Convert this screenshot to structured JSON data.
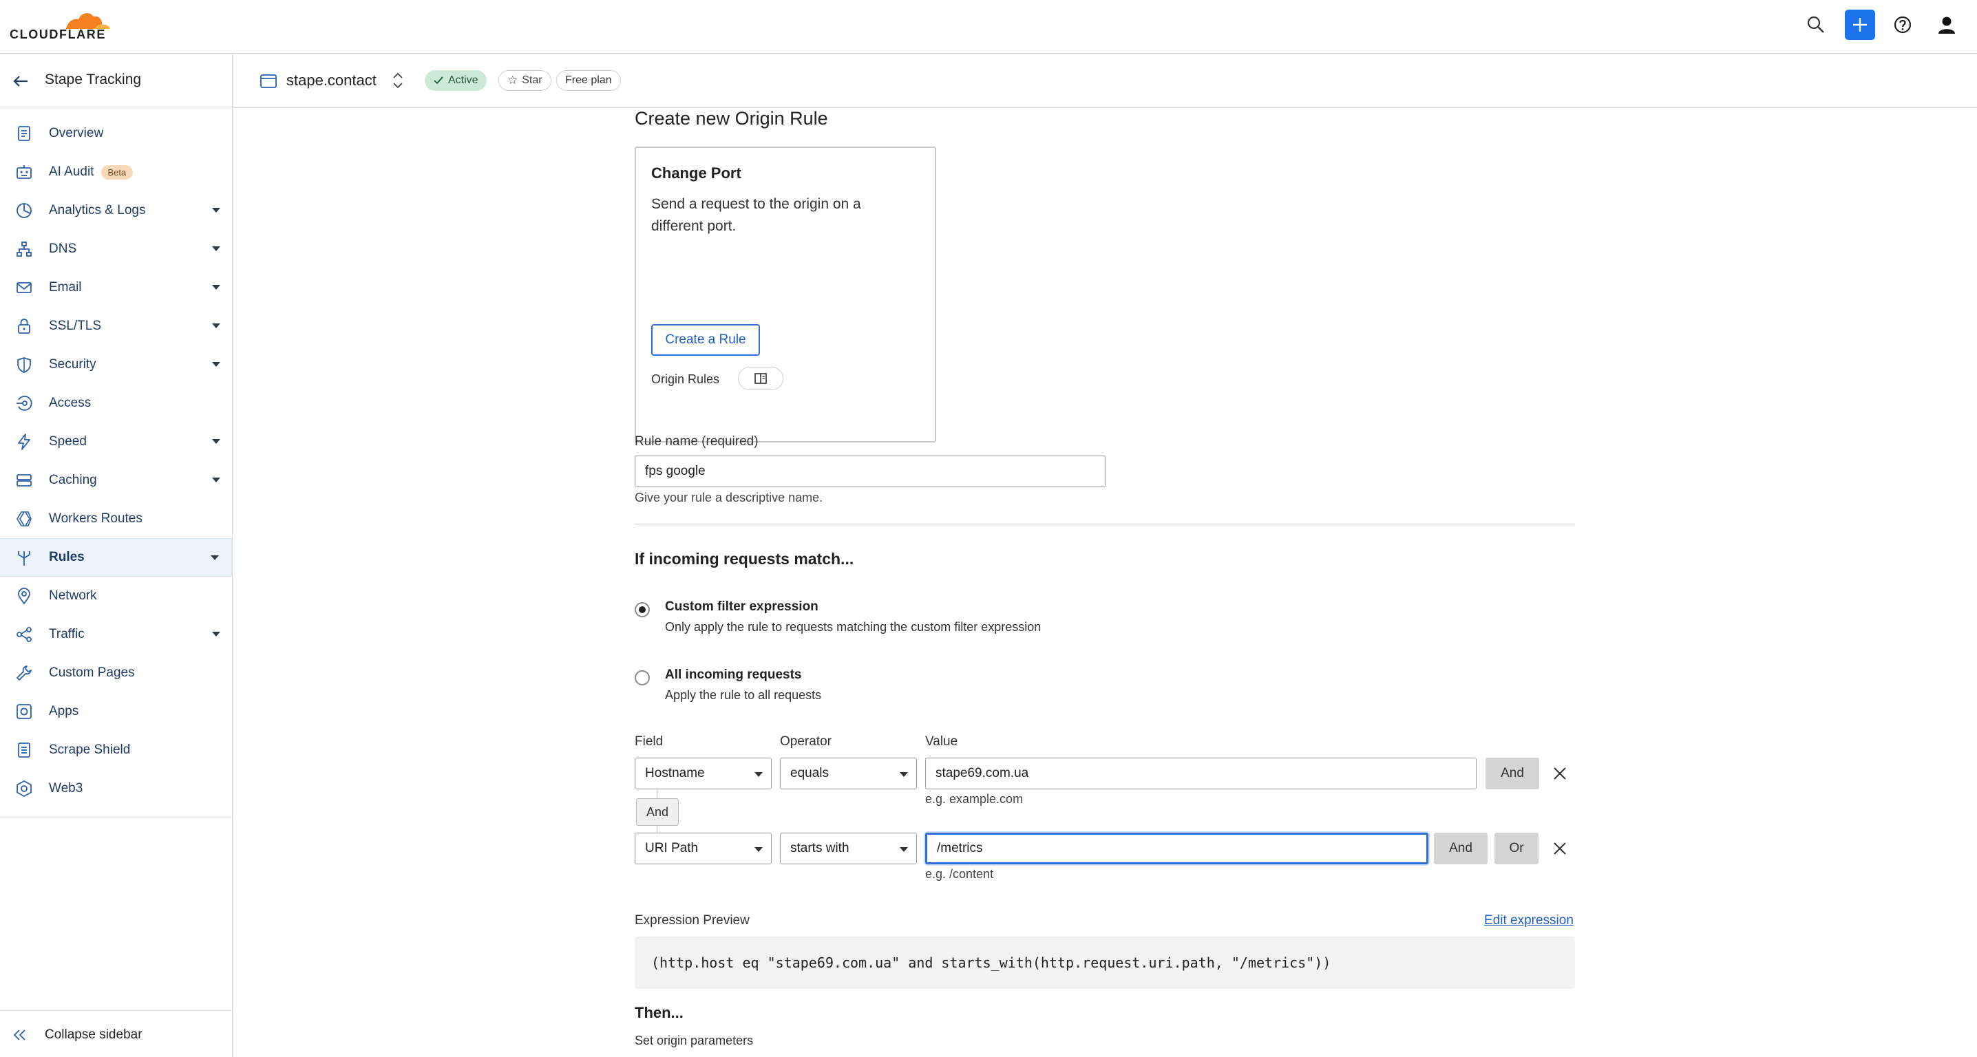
{
  "brand": {
    "name": "CLOUDFLARE",
    "orange": "#f48120",
    "accent": "#1a73e8"
  },
  "topbar": {
    "icons": [
      "search-icon",
      "plus-icon",
      "help-icon",
      "user-icon"
    ]
  },
  "sidebar": {
    "title": "Stape Tracking",
    "items": [
      {
        "label": "Overview",
        "icon": "overview-icon",
        "caret": false
      },
      {
        "label": "AI Audit",
        "icon": "ai-audit-icon",
        "caret": false,
        "badge": "Beta"
      },
      {
        "label": "Analytics & Logs",
        "icon": "analytics-icon",
        "caret": true
      },
      {
        "label": "DNS",
        "icon": "dns-icon",
        "caret": true
      },
      {
        "label": "Email",
        "icon": "email-icon",
        "caret": true
      },
      {
        "label": "SSL/TLS",
        "icon": "lock-icon",
        "caret": true
      },
      {
        "label": "Security",
        "icon": "shield-icon",
        "caret": true
      },
      {
        "label": "Access",
        "icon": "access-icon",
        "caret": false
      },
      {
        "label": "Speed",
        "icon": "bolt-icon",
        "caret": true
      },
      {
        "label": "Caching",
        "icon": "caching-icon",
        "caret": true
      },
      {
        "label": "Workers Routes",
        "icon": "workers-icon",
        "caret": false
      },
      {
        "label": "Rules",
        "icon": "rules-icon",
        "caret": true,
        "active": true
      },
      {
        "label": "Network",
        "icon": "network-icon",
        "caret": false
      },
      {
        "label": "Traffic",
        "icon": "traffic-icon",
        "caret": true
      },
      {
        "label": "Custom Pages",
        "icon": "wrench-icon",
        "caret": false
      },
      {
        "label": "Apps",
        "icon": "apps-icon",
        "caret": false
      },
      {
        "label": "Scrape Shield",
        "icon": "scrape-shield-icon",
        "caret": false
      },
      {
        "label": "Web3",
        "icon": "web3-icon",
        "caret": false
      }
    ],
    "collapse_label": "Collapse sidebar"
  },
  "zone": {
    "name": "stape.contact",
    "status": "Active",
    "star": "Star",
    "plan": "Free plan"
  },
  "page": {
    "title": "Create new Origin Rule",
    "template_card": {
      "title": "Change Port",
      "description": "Send a request to the origin on a different port.",
      "button": "Create a Rule",
      "link_label": "Origin Rules"
    },
    "rule_name": {
      "label": "Rule name (required)",
      "value": "fps google",
      "help": "Give your rule a descriptive name."
    },
    "match_title": "If incoming requests match...",
    "match_options": [
      {
        "title": "Custom filter expression",
        "description": "Only apply the rule to requests matching the custom filter expression",
        "checked": true
      },
      {
        "title": "All incoming requests",
        "description": "Apply the rule to all requests",
        "checked": false
      }
    ],
    "builder": {
      "field_header": "Field",
      "operator_header": "Operator",
      "value_header": "Value",
      "rows": [
        {
          "field": "Hostname",
          "operator": "equals",
          "value": "stape69.com.ua",
          "hint": "e.g. example.com",
          "and": "And"
        },
        {
          "field": "URI Path",
          "operator": "starts with",
          "value": "/metrics",
          "hint": "e.g. /content",
          "and": "And",
          "or": "Or"
        }
      ],
      "joiner": "And"
    },
    "expression_preview": {
      "label": "Expression Preview",
      "edit_link": "Edit expression",
      "code": "(http.host eq \"stape69.com.ua\" and starts_with(http.request.uri.path, \"/metrics\"))"
    },
    "then_title": "Then...",
    "set_origin": "Set origin parameters"
  }
}
